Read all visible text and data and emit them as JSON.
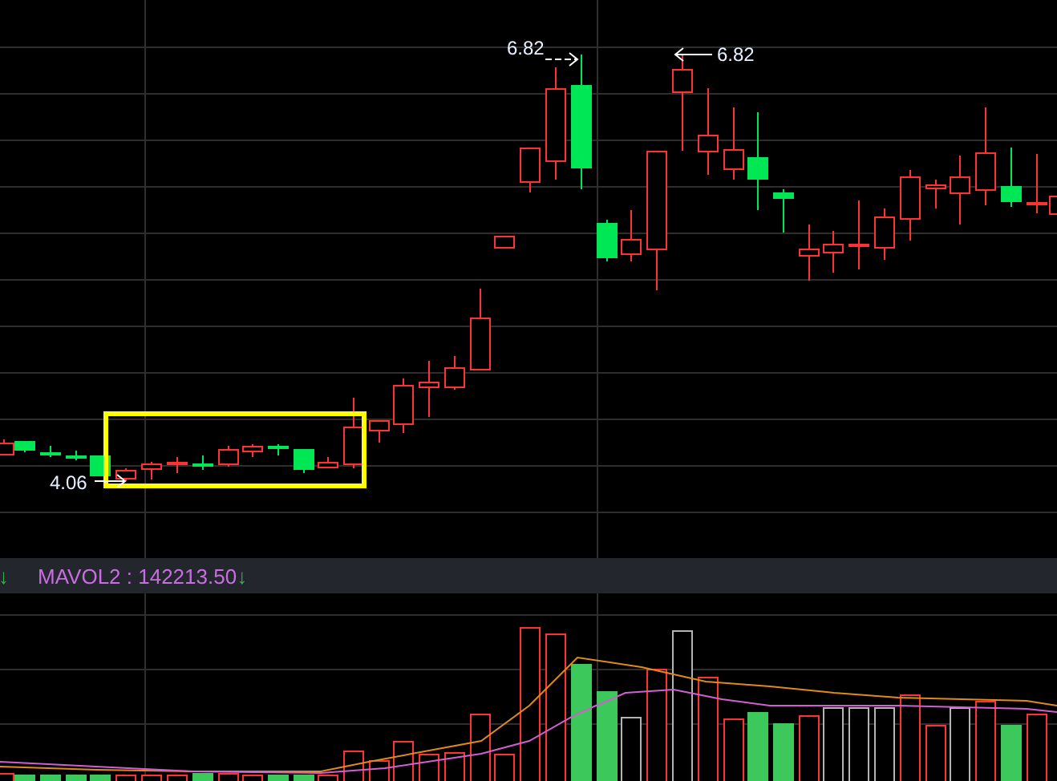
{
  "price_panel": {
    "annotations": [
      {
        "label": "6.82",
        "kind": "points_right"
      },
      {
        "label": "6.82",
        "kind": "points_left"
      },
      {
        "label": "4.06",
        "kind": "points_right"
      }
    ]
  },
  "volume_panel": {
    "legend": {
      "marker_left": "↓",
      "text": "MAVOL2 : 142213.50",
      "marker_right": "↓"
    }
  }
}
